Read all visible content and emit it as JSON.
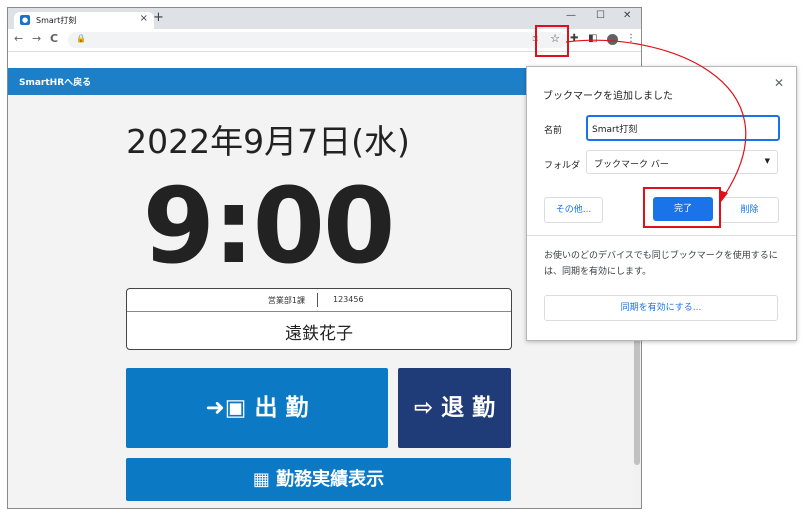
{
  "browser": {
    "tab_title": "Smart打刻",
    "tab_close": "×",
    "new_tab": "+",
    "win_min": "—",
    "win_max": "☐",
    "win_close": "✕",
    "back": "←",
    "forward": "→",
    "reload": "C",
    "lock": "🔒",
    "omni_key": "⚿",
    "star": "☆"
  },
  "page": {
    "back_link": "SmartHRへ戻る",
    "date": "2022年9月7日(水)",
    "time": "9:00",
    "department": "営業部1課",
    "employee_id": "123456",
    "employee_name": "遠鉄花子",
    "clock_in_label": "出 勤",
    "clock_out_label": "退 勤",
    "records_label": "勤務実績表示"
  },
  "bookmark_popup": {
    "title": "ブックマークを追加しました",
    "close": "✕",
    "name_label": "名前",
    "name_value": "Smart打刻",
    "folder_label": "フォルダ",
    "folder_value": "ブックマーク バー",
    "more_button": "その他...",
    "done_button": "完了",
    "delete_button": "削除",
    "sync_info": "お使いのどのデバイスでも同じブックマークを使用するには、同期を有効にします。",
    "sync_button": "同期を有効にする..."
  },
  "colors": {
    "blue_bar": "#1e7fc9",
    "clock_in_bg": "#0b79c4",
    "clock_out_bg": "#1f3c78",
    "highlight": "#e0101a",
    "chrome_blue": "#1a73e8"
  }
}
